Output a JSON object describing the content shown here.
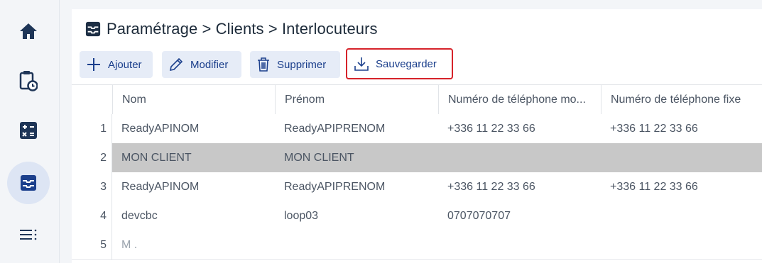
{
  "sidebar": {
    "items": [
      {
        "icon": "home-icon"
      },
      {
        "icon": "clipboard-clock-icon"
      },
      {
        "icon": "calculator-icon"
      },
      {
        "icon": "inbox-tray-icon",
        "active": true
      },
      {
        "icon": "list-menu-icon"
      }
    ]
  },
  "header": {
    "icon": "inbox-tray-icon",
    "title": "Paramétrage > Clients > Interlocuteurs"
  },
  "toolbar": {
    "add_label": "Ajouter",
    "edit_label": "Modifier",
    "delete_label": "Supprimer",
    "save_label": "Sauvegarder"
  },
  "grid": {
    "columns": [
      "Nom",
      "Prénom",
      "Numéro de téléphone mo...",
      "Numéro de téléphone fixe"
    ],
    "rows": [
      {
        "index": "1",
        "nom": "ReadyAPINOM",
        "prenom": "ReadyAPIPRENOM",
        "mobile": "+336 11 22 33 66",
        "fixe": "+336 11 22 33 66"
      },
      {
        "index": "2",
        "nom": "MON CLIENT",
        "prenom": "MON CLIENT",
        "mobile": "",
        "fixe": ""
      },
      {
        "index": "3",
        "nom": "ReadyAPINOM",
        "prenom": "ReadyAPIPRENOM",
        "mobile": "+336 11 22 33 66",
        "fixe": "+336 11 22 33 66"
      },
      {
        "index": "4",
        "nom": "devcbc",
        "prenom": "loop03",
        "mobile": "0707070707",
        "fixe": ""
      },
      {
        "index": "5",
        "nom": "M . ",
        "prenom": "",
        "mobile": "",
        "fixe": ""
      }
    ]
  },
  "colors": {
    "accent": "#1b3f8c",
    "button_bg": "#e6ecf7",
    "highlight_border": "#d6232a",
    "selected_row": "#c8c8c8",
    "sidebar_active": "#dde5f4"
  }
}
